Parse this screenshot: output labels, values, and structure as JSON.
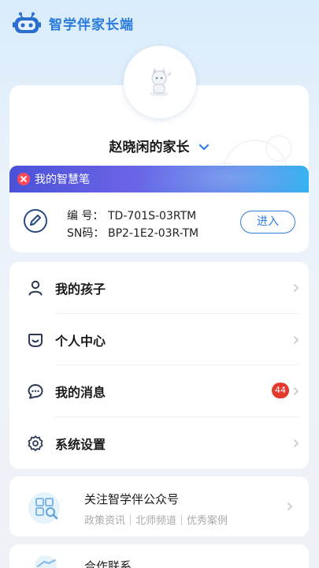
{
  "app": {
    "title": "智学伴家长端"
  },
  "profile": {
    "parent_name": "赵晓闲的家长"
  },
  "pen": {
    "banner_title": "我的智慧笔",
    "id_label": "编 号：",
    "id_value": "TD-701S-03RTM",
    "sn_label": "SN码：",
    "sn_value": "BP2-1E2-03R-TM",
    "enter_label": "进入"
  },
  "menu": {
    "items": [
      {
        "label": "我的孩子",
        "icon": "person-icon"
      },
      {
        "label": "个人中心",
        "icon": "smile-icon"
      },
      {
        "label": "我的消息",
        "icon": "chat-icon",
        "badge": "44"
      },
      {
        "label": "系统设置",
        "icon": "gear-icon"
      }
    ]
  },
  "follow": {
    "title": "关注智学伴公众号",
    "subtitle": "政策资讯｜北师频道｜优秀案例"
  },
  "contact": {
    "title": "合作联系"
  },
  "colors": {
    "accent": "#2f7de0",
    "badge": "#e23b2e",
    "banner_start": "#4a52d8",
    "banner_end": "#2fb0f0"
  }
}
